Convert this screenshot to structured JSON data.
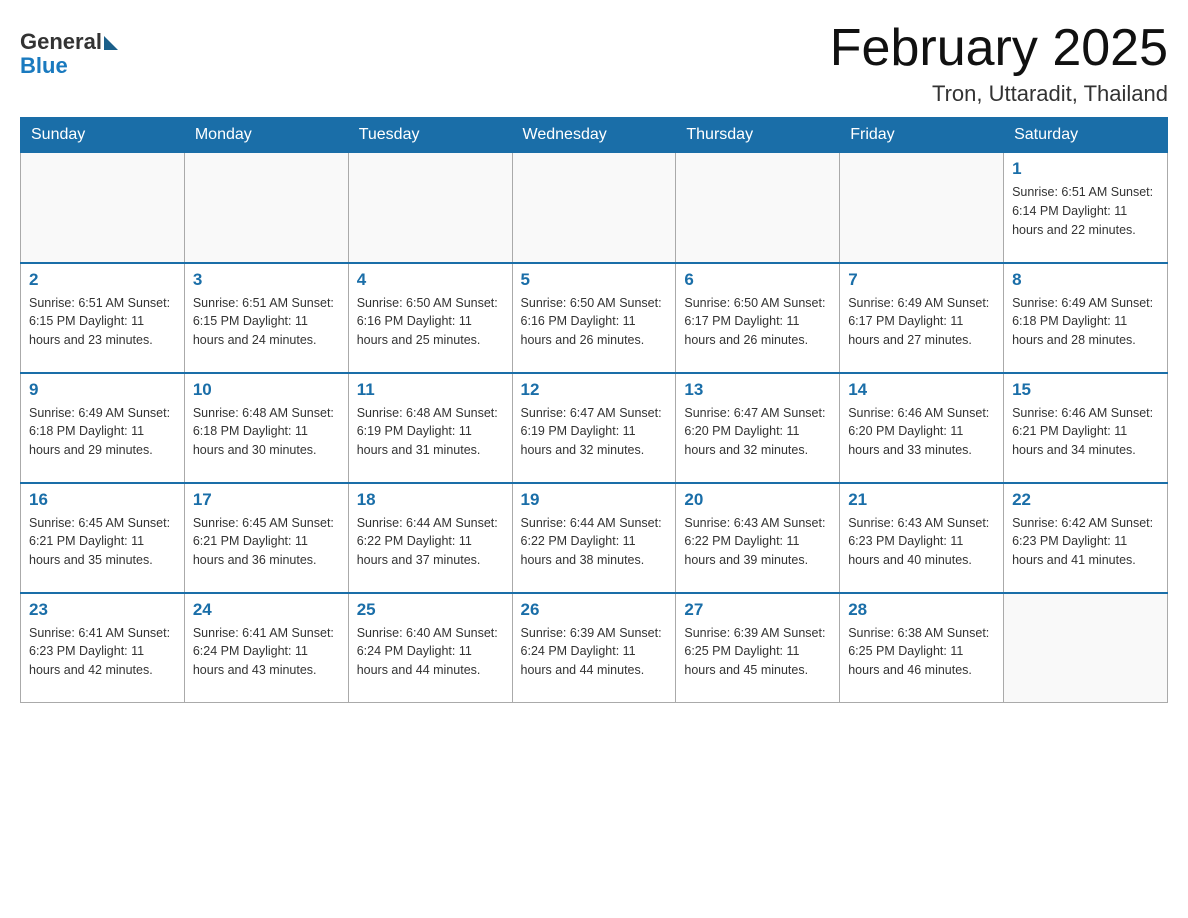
{
  "header": {
    "logo_general": "General",
    "logo_blue": "Blue",
    "month_title": "February 2025",
    "location": "Tron, Uttaradit, Thailand"
  },
  "days_of_week": [
    "Sunday",
    "Monday",
    "Tuesday",
    "Wednesday",
    "Thursday",
    "Friday",
    "Saturday"
  ],
  "weeks": [
    [
      {
        "day": "",
        "info": ""
      },
      {
        "day": "",
        "info": ""
      },
      {
        "day": "",
        "info": ""
      },
      {
        "day": "",
        "info": ""
      },
      {
        "day": "",
        "info": ""
      },
      {
        "day": "",
        "info": ""
      },
      {
        "day": "1",
        "info": "Sunrise: 6:51 AM\nSunset: 6:14 PM\nDaylight: 11 hours\nand 22 minutes."
      }
    ],
    [
      {
        "day": "2",
        "info": "Sunrise: 6:51 AM\nSunset: 6:15 PM\nDaylight: 11 hours\nand 23 minutes."
      },
      {
        "day": "3",
        "info": "Sunrise: 6:51 AM\nSunset: 6:15 PM\nDaylight: 11 hours\nand 24 minutes."
      },
      {
        "day": "4",
        "info": "Sunrise: 6:50 AM\nSunset: 6:16 PM\nDaylight: 11 hours\nand 25 minutes."
      },
      {
        "day": "5",
        "info": "Sunrise: 6:50 AM\nSunset: 6:16 PM\nDaylight: 11 hours\nand 26 minutes."
      },
      {
        "day": "6",
        "info": "Sunrise: 6:50 AM\nSunset: 6:17 PM\nDaylight: 11 hours\nand 26 minutes."
      },
      {
        "day": "7",
        "info": "Sunrise: 6:49 AM\nSunset: 6:17 PM\nDaylight: 11 hours\nand 27 minutes."
      },
      {
        "day": "8",
        "info": "Sunrise: 6:49 AM\nSunset: 6:18 PM\nDaylight: 11 hours\nand 28 minutes."
      }
    ],
    [
      {
        "day": "9",
        "info": "Sunrise: 6:49 AM\nSunset: 6:18 PM\nDaylight: 11 hours\nand 29 minutes."
      },
      {
        "day": "10",
        "info": "Sunrise: 6:48 AM\nSunset: 6:18 PM\nDaylight: 11 hours\nand 30 minutes."
      },
      {
        "day": "11",
        "info": "Sunrise: 6:48 AM\nSunset: 6:19 PM\nDaylight: 11 hours\nand 31 minutes."
      },
      {
        "day": "12",
        "info": "Sunrise: 6:47 AM\nSunset: 6:19 PM\nDaylight: 11 hours\nand 32 minutes."
      },
      {
        "day": "13",
        "info": "Sunrise: 6:47 AM\nSunset: 6:20 PM\nDaylight: 11 hours\nand 32 minutes."
      },
      {
        "day": "14",
        "info": "Sunrise: 6:46 AM\nSunset: 6:20 PM\nDaylight: 11 hours\nand 33 minutes."
      },
      {
        "day": "15",
        "info": "Sunrise: 6:46 AM\nSunset: 6:21 PM\nDaylight: 11 hours\nand 34 minutes."
      }
    ],
    [
      {
        "day": "16",
        "info": "Sunrise: 6:45 AM\nSunset: 6:21 PM\nDaylight: 11 hours\nand 35 minutes."
      },
      {
        "day": "17",
        "info": "Sunrise: 6:45 AM\nSunset: 6:21 PM\nDaylight: 11 hours\nand 36 minutes."
      },
      {
        "day": "18",
        "info": "Sunrise: 6:44 AM\nSunset: 6:22 PM\nDaylight: 11 hours\nand 37 minutes."
      },
      {
        "day": "19",
        "info": "Sunrise: 6:44 AM\nSunset: 6:22 PM\nDaylight: 11 hours\nand 38 minutes."
      },
      {
        "day": "20",
        "info": "Sunrise: 6:43 AM\nSunset: 6:22 PM\nDaylight: 11 hours\nand 39 minutes."
      },
      {
        "day": "21",
        "info": "Sunrise: 6:43 AM\nSunset: 6:23 PM\nDaylight: 11 hours\nand 40 minutes."
      },
      {
        "day": "22",
        "info": "Sunrise: 6:42 AM\nSunset: 6:23 PM\nDaylight: 11 hours\nand 41 minutes."
      }
    ],
    [
      {
        "day": "23",
        "info": "Sunrise: 6:41 AM\nSunset: 6:23 PM\nDaylight: 11 hours\nand 42 minutes."
      },
      {
        "day": "24",
        "info": "Sunrise: 6:41 AM\nSunset: 6:24 PM\nDaylight: 11 hours\nand 43 minutes."
      },
      {
        "day": "25",
        "info": "Sunrise: 6:40 AM\nSunset: 6:24 PM\nDaylight: 11 hours\nand 44 minutes."
      },
      {
        "day": "26",
        "info": "Sunrise: 6:39 AM\nSunset: 6:24 PM\nDaylight: 11 hours\nand 44 minutes."
      },
      {
        "day": "27",
        "info": "Sunrise: 6:39 AM\nSunset: 6:25 PM\nDaylight: 11 hours\nand 45 minutes."
      },
      {
        "day": "28",
        "info": "Sunrise: 6:38 AM\nSunset: 6:25 PM\nDaylight: 11 hours\nand 46 minutes."
      },
      {
        "day": "",
        "info": ""
      }
    ]
  ]
}
